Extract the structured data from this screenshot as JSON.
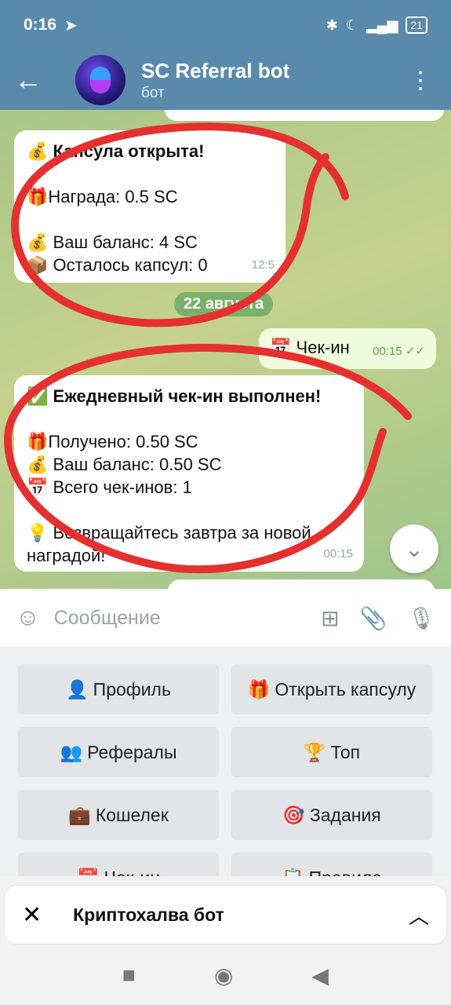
{
  "status": {
    "time": "0:16",
    "battery": "21"
  },
  "header": {
    "title": "SC Referral bot",
    "subtitle": "бот"
  },
  "messages": {
    "capsule": {
      "title": "Капсула открыта!",
      "reward": "Награда: 0.5 SC",
      "balance": "Ваш баланс: 4 SC",
      "left": "Осталось капсул: 0",
      "time": "12:5"
    },
    "date_divider": "22 августа",
    "checkin_out": {
      "text": "Чек-ин",
      "time": "00:15"
    },
    "checkin_reply": {
      "title": "Ежедневный чек-ин выполнен!",
      "received": "Получено: 0.50 SC",
      "balance": "Ваш баланс: 0.50 SC",
      "total": "Всего чек-инов: 1",
      "return": "Возвращайтесь завтра за новой наградой!",
      "time": "00:15"
    }
  },
  "composer": {
    "placeholder": "Сообщение"
  },
  "keyboard": [
    {
      "emoji": "👤",
      "label": "Профиль"
    },
    {
      "emoji": "🎁",
      "label": "Открыть капсулу"
    },
    {
      "emoji": "👥",
      "label": "Рефералы"
    },
    {
      "emoji": "🏆",
      "label": "Топ"
    },
    {
      "emoji": "💼",
      "label": "Кошелек"
    },
    {
      "emoji": "🎯",
      "label": "Задания"
    },
    {
      "emoji": "📅",
      "label": "Чек-ин"
    },
    {
      "emoji": "📋",
      "label": "Правила"
    }
  ],
  "panel": {
    "title": "Криптохалва бот"
  },
  "colors": {
    "header": "#5a8aab",
    "accent_green": "#7ab06a",
    "scribble": "#e53030"
  }
}
